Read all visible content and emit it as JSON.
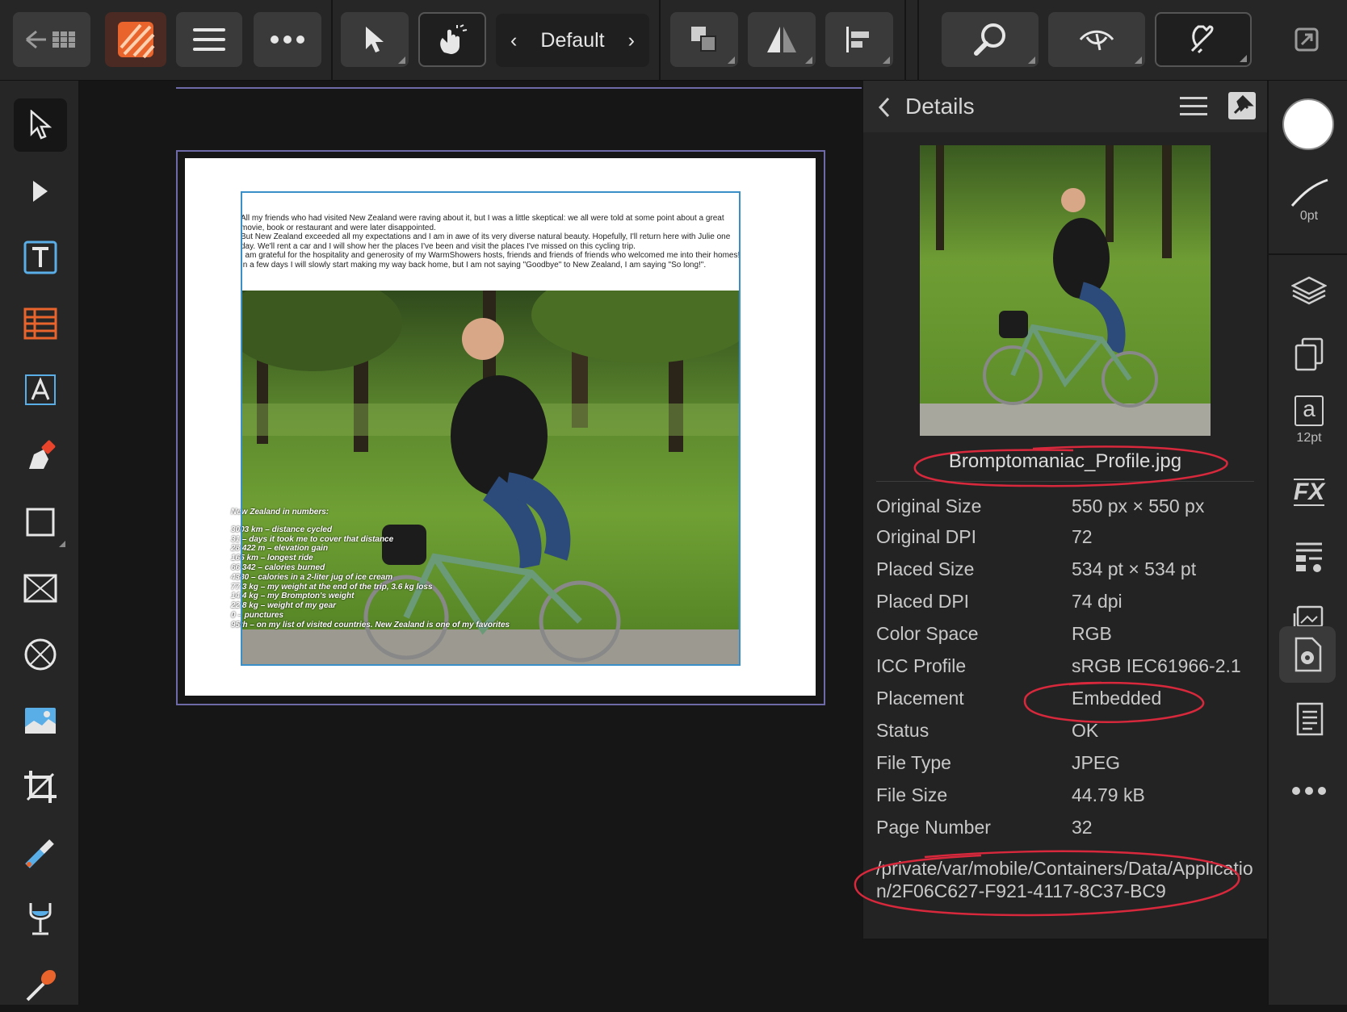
{
  "toolbar": {
    "persona_label": "Default"
  },
  "document": {
    "paragraph_1": "All my friends who had visited New Zealand were raving about it, but I was a little skeptical: we all were told at some point about a great movie, book or restaurant and were later disappointed.",
    "paragraph_2": "But New Zealand exceeded all my expectations and I am in awe of its very diverse natural beauty. Hopefully, I'll return here with Julie one day. We'll rent a car and I will show her the places I've been and visit the places I've missed on this cycling trip.",
    "paragraph_3": "I am grateful for the hospitality and generosity of my WarmShowers hosts, friends and friends of friends who welcomed me into their homes!",
    "paragraph_4": "In a few days I will slowly start making my way back home, but I am not saying \"Goodbye\" to New Zealand, I am saying \"So long!\".",
    "stats_title": "New Zealand in numbers:",
    "stats": [
      "3003 km – distance cycled",
      "31 – days it took me to cover that distance",
      "28 422 m – elevation gain",
      "165 km – longest ride",
      "66 342 – calories burned",
      "4380 – calories in a 2-liter jug of ice cream",
      "77.3 kg – my weight at the end of the trip, 3.6 kg loss",
      "14.4 kg – my Brompton's weight",
      "22.8 kg – weight of my gear",
      "0 – punctures",
      "95th – on my list of visited countries. New Zealand is one of my favorites"
    ]
  },
  "details": {
    "title": "Details",
    "file_name": "Bromptomaniac_Profile.jpg",
    "rows": [
      {
        "key": "Original Size",
        "value": "550 px × 550 px"
      },
      {
        "key": "Original DPI",
        "value": "72"
      },
      {
        "key": "Placed Size",
        "value": "534 pt × 534 pt"
      },
      {
        "key": "Placed DPI",
        "value": "74 dpi"
      },
      {
        "key": "Color Space",
        "value": "RGB"
      },
      {
        "key": "ICC Profile",
        "value": "sRGB IEC61966-2.1"
      },
      {
        "key": "Placement",
        "value": "Embedded"
      },
      {
        "key": "Status",
        "value": "OK"
      },
      {
        "key": "File Type",
        "value": "JPEG"
      },
      {
        "key": "File Size",
        "value": "44.79 kB"
      },
      {
        "key": "Page Number",
        "value": "32"
      }
    ],
    "path": "/private/var/mobile/Containers/Data/Application/2F06C627-F921-4117-8C37-BC9"
  },
  "rightbar": {
    "stroke_width": "0pt",
    "text_size": "12pt",
    "text_glyph": "a",
    "fx_label": "FX"
  },
  "colors": {
    "accent_orange": "#e8642c",
    "accent_blue": "#3a8fc8",
    "page_border": "#6e6aa8",
    "annotation_red": "#d8283c"
  }
}
